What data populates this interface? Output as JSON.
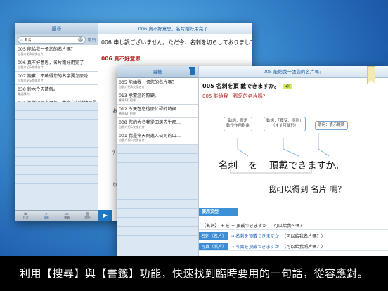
{
  "back_window": {
    "left_title": "搜尋",
    "search": {
      "value": "名片",
      "cancel": "取消"
    },
    "results": [
      {
        "title": "005 能給我一張您的名片嗎？",
        "sub": "自我介紹&交換名片"
      },
      {
        "title": "006 真不好意思，名片剛好用完了",
        "sub": "自我介紹&交換名片"
      },
      {
        "title": "007 抱歉，不曉得您的名字要怎麼唸",
        "sub": "自我介紹&交換名片"
      },
      {
        "title": "030 鈴木今天請假。",
        "sub": "電話應對"
      },
      {
        "title": "031 等業田回來之後，我會立刻請他回電",
        "sub": "電話應對"
      }
    ],
    "tabs": [
      {
        "icon": "☰",
        "label": "目次"
      },
      {
        "icon": "⌕",
        "label": "搜尋"
      },
      {
        "icon": "▭",
        "label": "書籤"
      },
      {
        "icon": "▤",
        "label": "說明"
      }
    ],
    "right_title": "006 真不好意思，名片剛好用完了…",
    "jp_line": "006 申し訳ございません。ただ今、名刺を切らしておりまして…",
    "cn_line": "006 真不好意思",
    "letter_a": "お",
    "letter_b": "？",
    "letter_c": "り"
  },
  "front_window": {
    "left_title": "書籤",
    "bookmarks": [
      {
        "title": "005 能給我一張您的名片嗎？",
        "sub": "自我介紹&交換名片"
      },
      {
        "title": "013 承蒙您的照顧。",
        "sub": "寒暄&打招呼"
      },
      {
        "title": "012 今天在您這麼忙碌的時候…",
        "sub": "寒暄&打招呼"
      },
      {
        "title": "008 您的大名我從田邊先生那…",
        "sub": "自我介紹&交換名片"
      },
      {
        "title": "001 我是今天剛進入公司的山…",
        "sub": "自我介紹&交換名片"
      }
    ],
    "right_title": "005 能給我一張您的名片嗎？",
    "jp_sentence": "005 名刺を頂 戴できますか。",
    "speaker_label": "◀))",
    "cn_sentence": "005 能給我一張您的名片嗎?",
    "bubbles": [
      "助詞：表示\n動作作用對象",
      "動詞：「獲受、得到」\n（ます可能形）",
      "助詞：表示疑問"
    ],
    "big_jp": [
      "名刺",
      "を",
      "頂戴できます",
      "か。"
    ],
    "big_cn": "我可以得到 名片 嗎？",
    "pattern_title": "使用文型",
    "pattern_rows": [
      {
        "a": "【名詞】 + を + 頂戴できますか",
        "b": "可以給我～嗎？"
      },
      {
        "chip": "名刺（名片）",
        "a": "→ 名刺を頂戴できますか",
        "b": "（可以給我名片嗎？）"
      },
      {
        "chip": "写真（照片）",
        "a": "→ 写真を頂戴できますか",
        "b": "（可以給我照片嗎？）"
      }
    ]
  },
  "caption": "利用【搜尋】與【書籤】功能，快速找到臨時要用的一句話，從容應對。"
}
